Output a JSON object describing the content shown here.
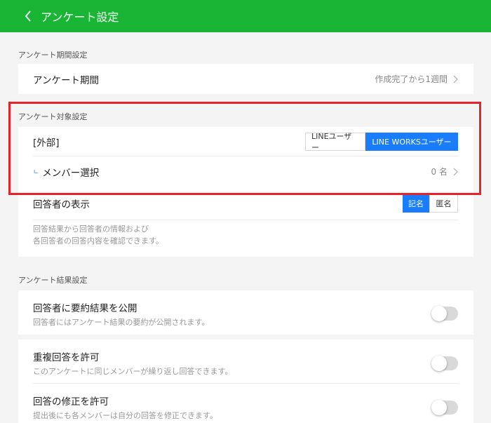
{
  "header": {
    "title": "アンケート設定",
    "bg_color": "#1bb535"
  },
  "period_section": {
    "title": "アンケート期間設定",
    "row_label": "アンケート期間",
    "row_value": "作成完了から1週間"
  },
  "target_section": {
    "title": "アンケート対象設定",
    "external_label": "[外部]",
    "seg_options": [
      "LINEユーザー",
      "LINE WORKSユーザー"
    ],
    "seg_selected": "LINE WORKSユーザー",
    "member_prefix": "ㄴ",
    "member_label": "メンバー選択",
    "member_count": "0 名"
  },
  "respondent_display": {
    "label": "回答者の表示",
    "seg_options": [
      "記名",
      "匿名"
    ],
    "seg_selected": "記名",
    "desc_line1": "回答結果から回答者の情報および",
    "desc_line2": "各回答者の回答内容を確認できます。"
  },
  "result_section": {
    "title": "アンケート結果設定",
    "publish": {
      "label": "回答者に要約結果を公開",
      "desc": "回答者にはアンケート結果の要約が公開されます。",
      "enabled": false
    },
    "duplicate": {
      "label": "重複回答を許可",
      "desc": "このアンケートに同じメンバーが繰り返し回答できます。",
      "enabled": false
    },
    "edit": {
      "label": "回答の修正を許可",
      "desc": "提出後にも各メンバーは自分の回答を修正できます。",
      "enabled": false
    }
  },
  "colors": {
    "accent": "#1a7dff",
    "highlight": "#e5232b"
  }
}
